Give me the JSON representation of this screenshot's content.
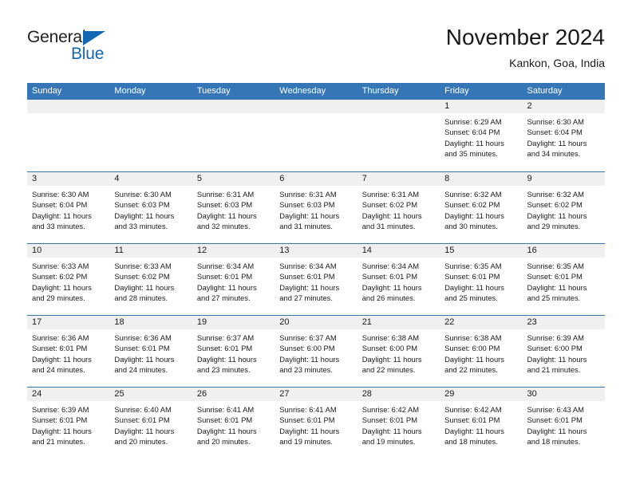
{
  "brand": {
    "name_top": "General",
    "name_bottom": "Blue",
    "triangle_icon": "triangle-icon",
    "color_dark": "#231f20",
    "color_blue": "#1565b5"
  },
  "header": {
    "title": "November 2024",
    "subtitle": "Kankon, Goa, India"
  },
  "theme": {
    "header_blue": "#3576b7",
    "day_band_grey": "#f0f0f0",
    "text_dark": "#1a1a1a"
  },
  "weekdays": [
    "Sunday",
    "Monday",
    "Tuesday",
    "Wednesday",
    "Thursday",
    "Friday",
    "Saturday"
  ],
  "weeks": [
    [
      {
        "day": "",
        "lines": []
      },
      {
        "day": "",
        "lines": []
      },
      {
        "day": "",
        "lines": []
      },
      {
        "day": "",
        "lines": []
      },
      {
        "day": "",
        "lines": []
      },
      {
        "day": "1",
        "lines": [
          "Sunrise: 6:29 AM",
          "Sunset: 6:04 PM",
          "Daylight: 11 hours",
          "and 35 minutes."
        ]
      },
      {
        "day": "2",
        "lines": [
          "Sunrise: 6:30 AM",
          "Sunset: 6:04 PM",
          "Daylight: 11 hours",
          "and 34 minutes."
        ]
      }
    ],
    [
      {
        "day": "3",
        "lines": [
          "Sunrise: 6:30 AM",
          "Sunset: 6:04 PM",
          "Daylight: 11 hours",
          "and 33 minutes."
        ]
      },
      {
        "day": "4",
        "lines": [
          "Sunrise: 6:30 AM",
          "Sunset: 6:03 PM",
          "Daylight: 11 hours",
          "and 33 minutes."
        ]
      },
      {
        "day": "5",
        "lines": [
          "Sunrise: 6:31 AM",
          "Sunset: 6:03 PM",
          "Daylight: 11 hours",
          "and 32 minutes."
        ]
      },
      {
        "day": "6",
        "lines": [
          "Sunrise: 6:31 AM",
          "Sunset: 6:03 PM",
          "Daylight: 11 hours",
          "and 31 minutes."
        ]
      },
      {
        "day": "7",
        "lines": [
          "Sunrise: 6:31 AM",
          "Sunset: 6:02 PM",
          "Daylight: 11 hours",
          "and 31 minutes."
        ]
      },
      {
        "day": "8",
        "lines": [
          "Sunrise: 6:32 AM",
          "Sunset: 6:02 PM",
          "Daylight: 11 hours",
          "and 30 minutes."
        ]
      },
      {
        "day": "9",
        "lines": [
          "Sunrise: 6:32 AM",
          "Sunset: 6:02 PM",
          "Daylight: 11 hours",
          "and 29 minutes."
        ]
      }
    ],
    [
      {
        "day": "10",
        "lines": [
          "Sunrise: 6:33 AM",
          "Sunset: 6:02 PM",
          "Daylight: 11 hours",
          "and 29 minutes."
        ]
      },
      {
        "day": "11",
        "lines": [
          "Sunrise: 6:33 AM",
          "Sunset: 6:02 PM",
          "Daylight: 11 hours",
          "and 28 minutes."
        ]
      },
      {
        "day": "12",
        "lines": [
          "Sunrise: 6:34 AM",
          "Sunset: 6:01 PM",
          "Daylight: 11 hours",
          "and 27 minutes."
        ]
      },
      {
        "day": "13",
        "lines": [
          "Sunrise: 6:34 AM",
          "Sunset: 6:01 PM",
          "Daylight: 11 hours",
          "and 27 minutes."
        ]
      },
      {
        "day": "14",
        "lines": [
          "Sunrise: 6:34 AM",
          "Sunset: 6:01 PM",
          "Daylight: 11 hours",
          "and 26 minutes."
        ]
      },
      {
        "day": "15",
        "lines": [
          "Sunrise: 6:35 AM",
          "Sunset: 6:01 PM",
          "Daylight: 11 hours",
          "and 25 minutes."
        ]
      },
      {
        "day": "16",
        "lines": [
          "Sunrise: 6:35 AM",
          "Sunset: 6:01 PM",
          "Daylight: 11 hours",
          "and 25 minutes."
        ]
      }
    ],
    [
      {
        "day": "17",
        "lines": [
          "Sunrise: 6:36 AM",
          "Sunset: 6:01 PM",
          "Daylight: 11 hours",
          "and 24 minutes."
        ]
      },
      {
        "day": "18",
        "lines": [
          "Sunrise: 6:36 AM",
          "Sunset: 6:01 PM",
          "Daylight: 11 hours",
          "and 24 minutes."
        ]
      },
      {
        "day": "19",
        "lines": [
          "Sunrise: 6:37 AM",
          "Sunset: 6:01 PM",
          "Daylight: 11 hours",
          "and 23 minutes."
        ]
      },
      {
        "day": "20",
        "lines": [
          "Sunrise: 6:37 AM",
          "Sunset: 6:00 PM",
          "Daylight: 11 hours",
          "and 23 minutes."
        ]
      },
      {
        "day": "21",
        "lines": [
          "Sunrise: 6:38 AM",
          "Sunset: 6:00 PM",
          "Daylight: 11 hours",
          "and 22 minutes."
        ]
      },
      {
        "day": "22",
        "lines": [
          "Sunrise: 6:38 AM",
          "Sunset: 6:00 PM",
          "Daylight: 11 hours",
          "and 22 minutes."
        ]
      },
      {
        "day": "23",
        "lines": [
          "Sunrise: 6:39 AM",
          "Sunset: 6:00 PM",
          "Daylight: 11 hours",
          "and 21 minutes."
        ]
      }
    ],
    [
      {
        "day": "24",
        "lines": [
          "Sunrise: 6:39 AM",
          "Sunset: 6:01 PM",
          "Daylight: 11 hours",
          "and 21 minutes."
        ]
      },
      {
        "day": "25",
        "lines": [
          "Sunrise: 6:40 AM",
          "Sunset: 6:01 PM",
          "Daylight: 11 hours",
          "and 20 minutes."
        ]
      },
      {
        "day": "26",
        "lines": [
          "Sunrise: 6:41 AM",
          "Sunset: 6:01 PM",
          "Daylight: 11 hours",
          "and 20 minutes."
        ]
      },
      {
        "day": "27",
        "lines": [
          "Sunrise: 6:41 AM",
          "Sunset: 6:01 PM",
          "Daylight: 11 hours",
          "and 19 minutes."
        ]
      },
      {
        "day": "28",
        "lines": [
          "Sunrise: 6:42 AM",
          "Sunset: 6:01 PM",
          "Daylight: 11 hours",
          "and 19 minutes."
        ]
      },
      {
        "day": "29",
        "lines": [
          "Sunrise: 6:42 AM",
          "Sunset: 6:01 PM",
          "Daylight: 11 hours",
          "and 18 minutes."
        ]
      },
      {
        "day": "30",
        "lines": [
          "Sunrise: 6:43 AM",
          "Sunset: 6:01 PM",
          "Daylight: 11 hours",
          "and 18 minutes."
        ]
      }
    ]
  ]
}
